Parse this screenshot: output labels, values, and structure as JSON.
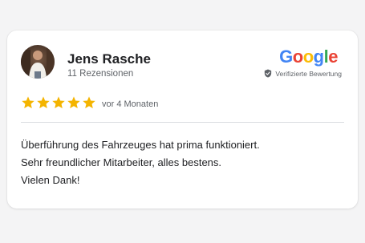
{
  "review": {
    "reviewer_name": "Jens Rasche",
    "reviewer_subtitle": "11 Rezensionen",
    "rating": 5,
    "rating_max": 5,
    "date": "vor 4 Monaten",
    "text_lines": [
      "Überführung des Fahrzeuges hat prima funktioniert.",
      "Sehr freundlicher Mitarbeiter, alles bestens.",
      "Vielen Dank!"
    ]
  },
  "brand": {
    "logo_text": "Google",
    "logo_letters": [
      "G",
      "o",
      "o",
      "g",
      "l",
      "e"
    ],
    "verified_label": "Verifizierte Bewertung"
  },
  "icons": {
    "star": "star-icon",
    "verified": "verified-check-icon",
    "avatar": "reviewer-avatar"
  },
  "colors": {
    "star": "#f4b400",
    "google_blue": "#4285f4",
    "google_red": "#ea4335",
    "google_yellow": "#fbbc05",
    "google_green": "#34a853",
    "text_primary": "#202124",
    "text_secondary": "#5f6368"
  }
}
